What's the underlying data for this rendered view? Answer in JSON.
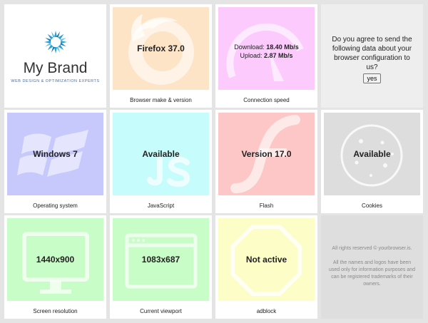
{
  "brand": {
    "name": "My Brand",
    "tagline": "WEB DESIGN & OPTIMIZATION EXPERTS",
    "logo_icon": "starburst-logo-icon",
    "logo_color": "#2a9fd6"
  },
  "tiles": {
    "browser": {
      "value": "Firefox 37.0",
      "caption": "Browser make & version",
      "bg": "#fde4c7",
      "icon": "firefox-icon"
    },
    "speed": {
      "download_label": "Download:",
      "download_value": "18.40 Mb/s",
      "upload_label": "Upload:",
      "upload_value": "2.87 Mb/s",
      "caption": "Connection speed",
      "bg": "#fccafc",
      "icon": "speedometer-icon"
    },
    "os": {
      "value": "Windows 7",
      "caption": "Operating system",
      "bg": "#c7c9fd",
      "icon": "windows-icon"
    },
    "js": {
      "value": "Available",
      "caption": "JavaScript",
      "bg": "#c7fcfd",
      "icon": "js-icon"
    },
    "flash": {
      "value": "Version 17.0",
      "caption": "Flash",
      "bg": "#fdc7c7",
      "icon": "flash-icon"
    },
    "cookies": {
      "value": "Available",
      "caption": "Cookies",
      "bg": "#dddddd",
      "icon": "cookie-icon"
    },
    "screen": {
      "value": "1440x900",
      "caption": "Screen resolution",
      "bg": "#c9fdc7",
      "icon": "monitor-icon"
    },
    "viewport": {
      "value": "1083x687",
      "caption": "Current viewport",
      "bg": "#c9fdc7",
      "icon": "browser-window-icon"
    },
    "adblock": {
      "value": "Not active",
      "caption": "adblock",
      "bg": "#fdfdc7",
      "icon": "stop-sign-icon"
    }
  },
  "consent": {
    "question": "Do you agree to send the following data about your browser configuration to us?",
    "yes_label": "yes"
  },
  "legal": {
    "rights": "All rights reserved © yourbrowser.is.",
    "disclaimer": "All the names and logos have been used only for information purposes and can be registered trademarks of their owners."
  }
}
